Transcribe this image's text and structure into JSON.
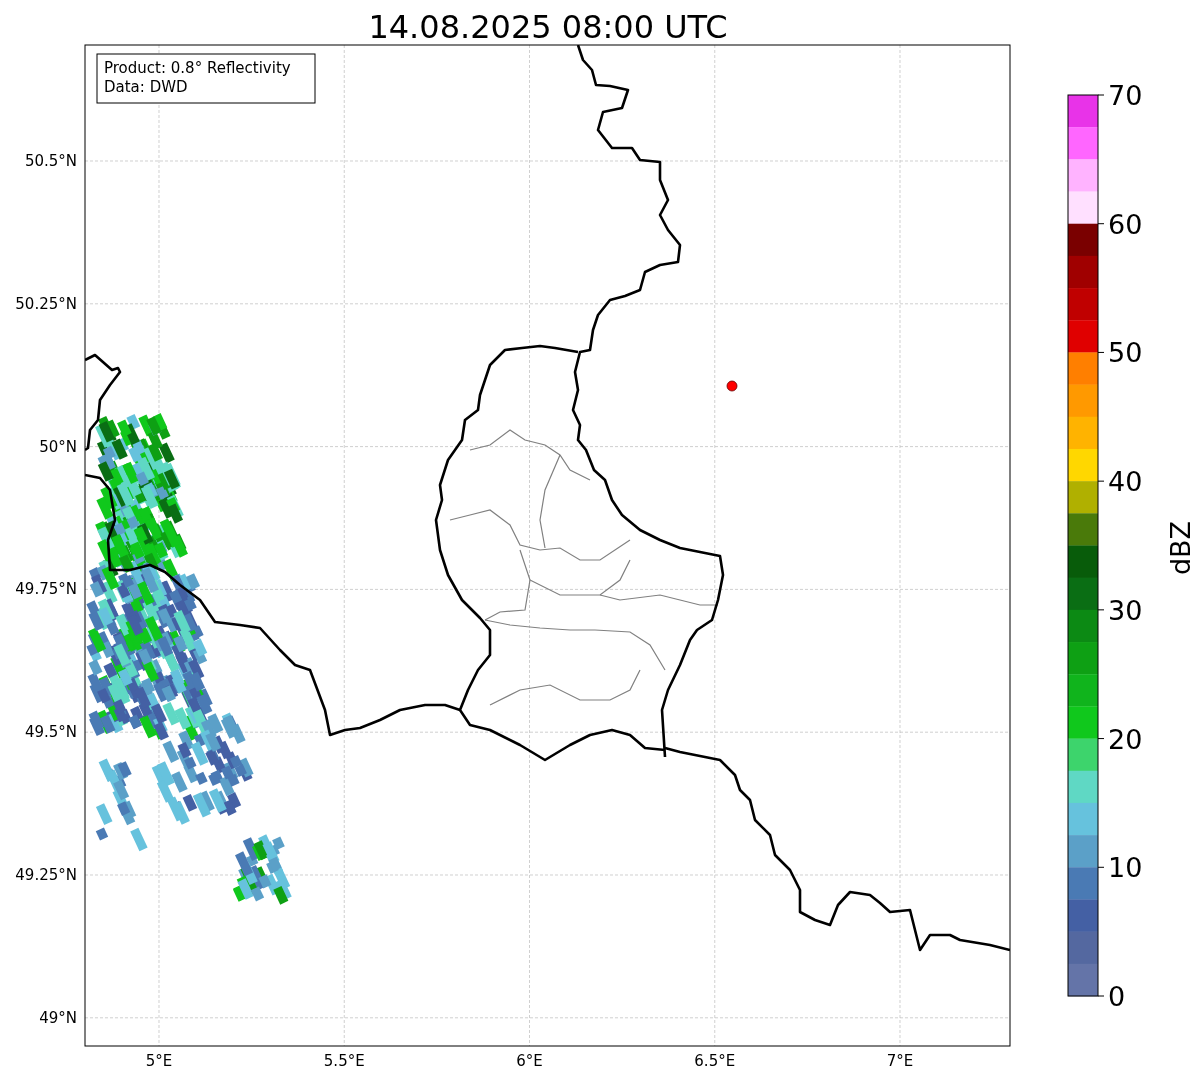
{
  "title": "14.08.2025 08:00 UTC",
  "info_box": {
    "lines": [
      "Product: 0.8° Reflectivity",
      "Data: DWD"
    ]
  },
  "map": {
    "y_ticks": [
      "50.5°N",
      "50.25°N",
      "50°N",
      "49.75°N",
      "49.5°N",
      "49.25°N",
      "49°N"
    ],
    "x_ticks": [
      "5°E",
      "5.5°E",
      "6°E",
      "6.5°E",
      "7°E"
    ]
  },
  "colorbar": {
    "label": "dBZ",
    "ticks": [
      "70",
      "60",
      "50",
      "40",
      "30",
      "20",
      "10",
      "0"
    ],
    "bins": [
      {
        "color": "#e833e8"
      },
      {
        "color": "#ff66ff"
      },
      {
        "color": "#ffb3ff"
      },
      {
        "color": "#ffe0ff"
      },
      {
        "color": "#7a0000"
      },
      {
        "color": "#a00000"
      },
      {
        "color": "#c00000"
      },
      {
        "color": "#e00000"
      },
      {
        "color": "#ff7f00"
      },
      {
        "color": "#ff9900"
      },
      {
        "color": "#ffb300"
      },
      {
        "color": "#ffd700"
      },
      {
        "color": "#b0b000"
      },
      {
        "color": "#4a7a0a"
      },
      {
        "color": "#085c0a"
      },
      {
        "color": "#0a6e14"
      },
      {
        "color": "#0c8a14"
      },
      {
        "color": "#0ea014"
      },
      {
        "color": "#10b41c"
      },
      {
        "color": "#10c81c"
      },
      {
        "color": "#3dd46c"
      },
      {
        "color": "#5fd8c4"
      },
      {
        "color": "#66c2dd"
      },
      {
        "color": "#5ba0c8"
      },
      {
        "color": "#4a7ab4"
      },
      {
        "color": "#4460a4"
      },
      {
        "color": "#5468a0"
      },
      {
        "color": "#6474a8"
      }
    ]
  }
}
